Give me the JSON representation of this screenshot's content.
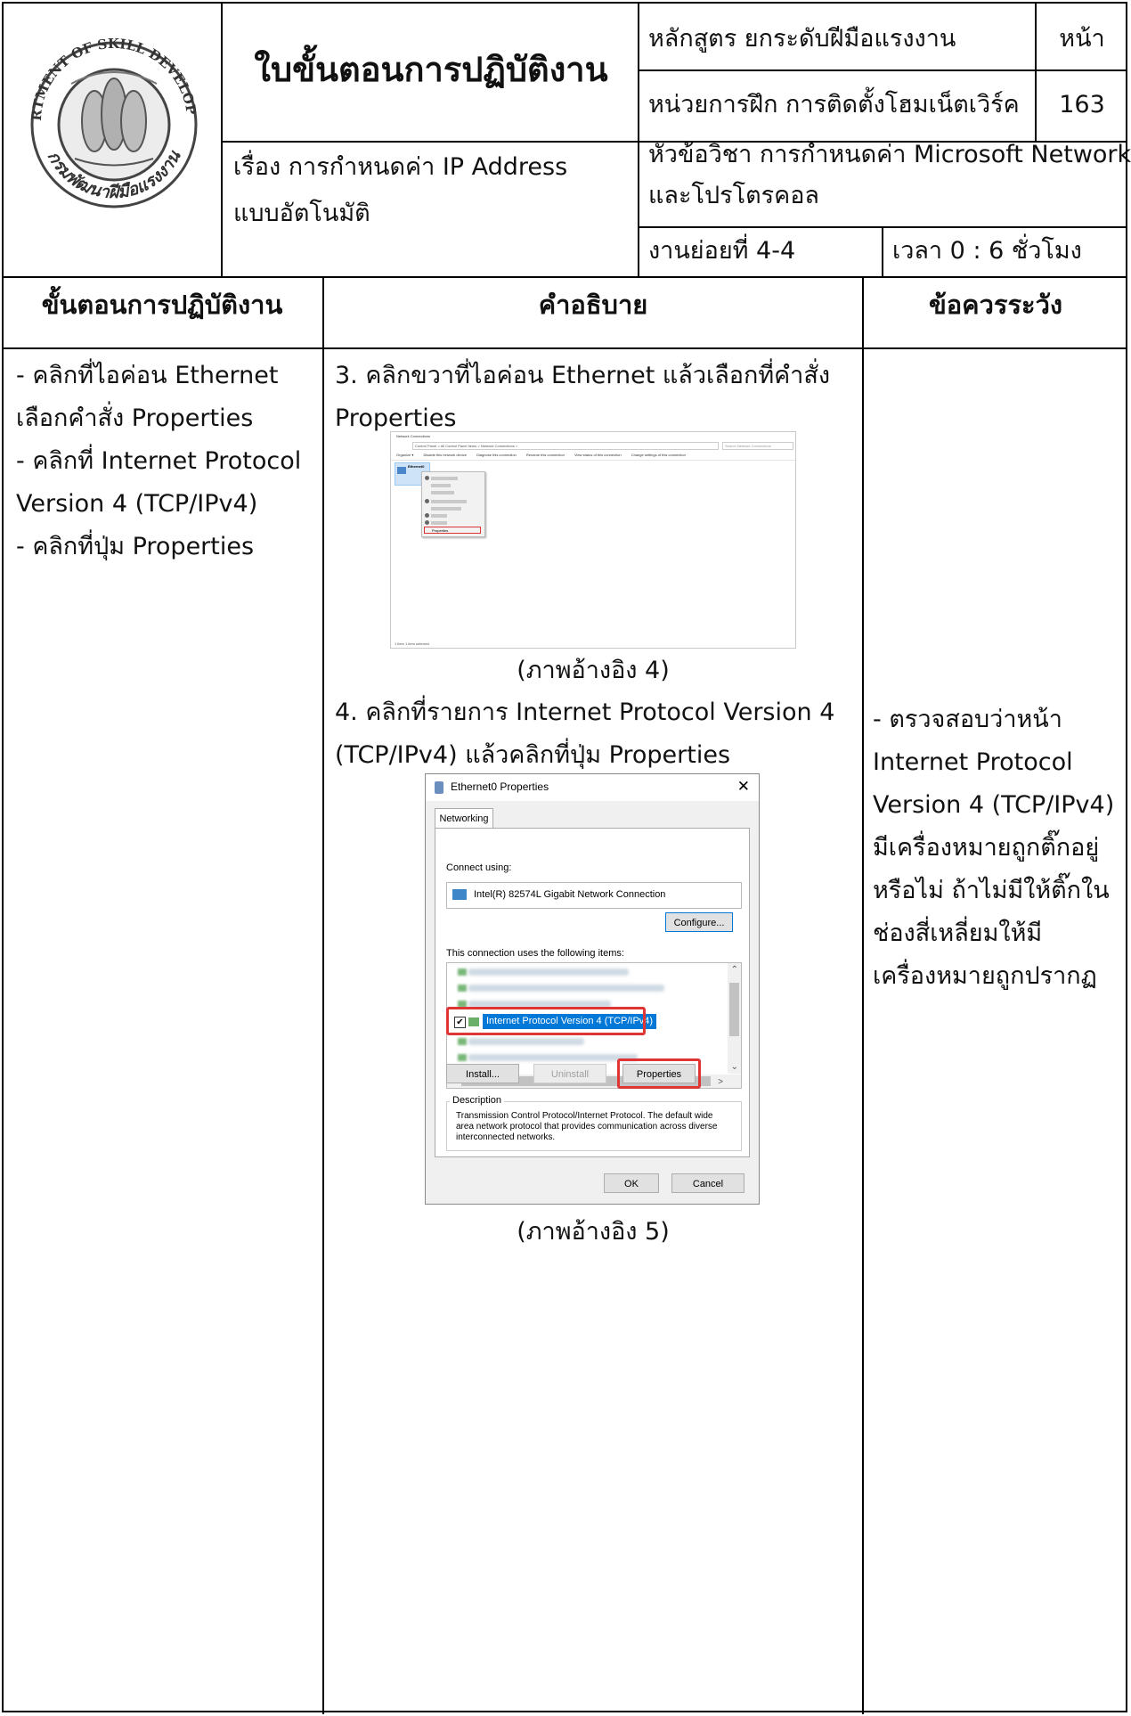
{
  "header": {
    "logo_text": "DEPARTMENT OF SKILL DEVELOPMENT กรมพัฒนาฝีมือแรงงาน",
    "title": "ใบขั้นตอนการปฏิบัติงาน",
    "subject_line1": "เรื่อง การกำหนดค่า IP Address",
    "subject_line2": "แบบอัตโนมัติ",
    "course": "หลักสูตร ยกระดับฝีมือแรงงาน",
    "page_label": "หน้า",
    "module": "หน่วยการฝึก การติดตั้งโฮมเน็ตเวิร์ค",
    "page_number": "163",
    "topic_line1": "หัวข้อวิชา การกำหนดค่า Microsoft Network",
    "topic_line2": "และโปรโตรคอล",
    "subtask": "งานย่อยที่   4-4",
    "time": "เวลา  0  :  6 ชั่วโมง"
  },
  "columns": {
    "steps": "ขั้นตอนการปฏิบัติงาน",
    "explanation": "คำอธิบาย",
    "cautions": "ข้อควรระวัง"
  },
  "steps": [
    "- คลิกที่ไอค่อน Ethernet",
    "เลือกคำสั่ง Properties",
    "- คลิกที่ Internet Protocol",
    "Version 4 (TCP/IPv4)",
    "- คลิกที่ปุ่ม Properties"
  ],
  "explanation": {
    "step3_line1": "3. คลิกขวาที่ไอค่อน Ethernet แล้วเลือกที่คำสั่ง",
    "step3_line2": "Properties",
    "caption4": "(ภาพอ้างอิง 4)",
    "step4_line1": "4. คลิกที่รายการ Internet Protocol Version 4",
    "step4_line2": "(TCP/IPv4) แล้วคลิกที่ปุ่ม Properties",
    "caption5": "(ภาพอ้างอิง 5)"
  },
  "cautions": [
    "- ตรวจสอบว่าหน้า",
    "Internet Protocol",
    "Version 4 (TCP/IPv4)",
    "มีเครื่องหมายถูกติ๊กอยู่",
    "หรือไม่ ถ้าไม่มีให้ติ๊กใน",
    "ช่องสี่เหลี่ยมให้มี",
    "เครื่องหมายถูกปรากฏ"
  ],
  "screenshot1": {
    "window_title": "Network Connections",
    "address": "Control Panel  >  All Control Panel Items  >  Network Connections  >",
    "search_placeholder": "Search Network Connections",
    "commands": [
      "Organize ▾",
      "Disable this network device",
      "Diagnose this connection",
      "Rename this connection",
      "View status of this connection",
      "Change settings of this connection"
    ],
    "adapter_label": "Ethernet0",
    "menu_properties": "Properties",
    "status": "1 item    1 item selected"
  },
  "screenshot2": {
    "title": "Ethernet0 Properties",
    "tab": "Networking",
    "connect_using": "Connect using:",
    "adapter": "Intel(R) 82574L Gigabit Network Connection",
    "configure": "Configure...",
    "items_label": "This connection uses the following items:",
    "selected_item": "Internet Protocol Version 4 (TCP/IPv4)",
    "install": "Install...",
    "uninstall": "Uninstall",
    "properties": "Properties",
    "description_label": "Description",
    "description": "Transmission Control Protocol/Internet Protocol. The default wide area network protocol that provides communication across diverse interconnected networks.",
    "ok": "OK",
    "cancel": "Cancel",
    "close_glyph": "✕"
  },
  "colors": {
    "border": "#000000",
    "selection": "#0078d7",
    "highlight": "#e03535"
  }
}
